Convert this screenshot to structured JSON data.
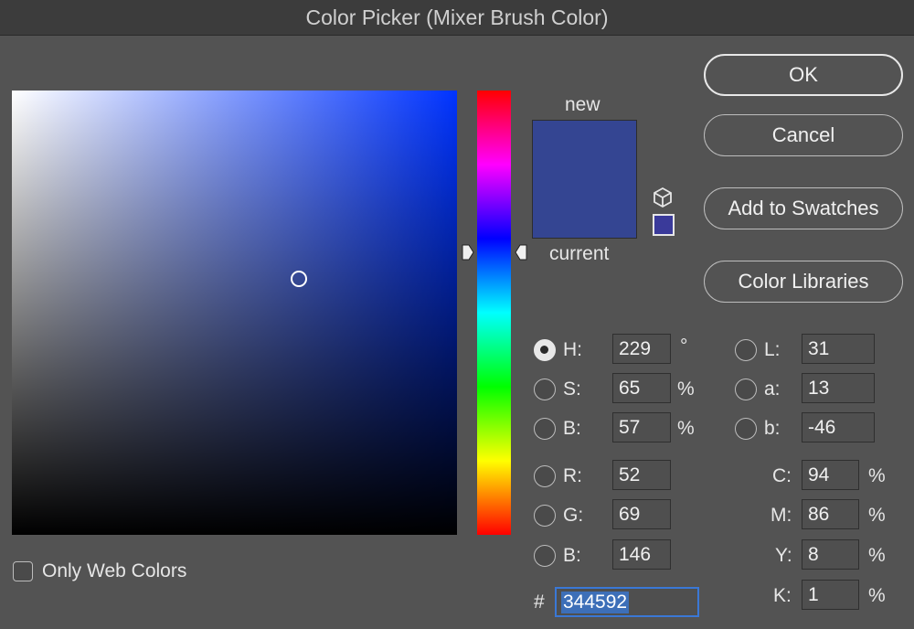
{
  "window": {
    "title": "Color Picker (Mixer Brush Color)"
  },
  "colors": {
    "new": "#344592",
    "current": "#344592",
    "gamut": "#3a3a9a"
  },
  "swatch": {
    "new_label": "new",
    "current_label": "current"
  },
  "buttons": {
    "ok": "OK",
    "cancel": "Cancel",
    "add_to_swatches": "Add to Swatches",
    "color_libraries": "Color Libraries"
  },
  "hsb": {
    "h": {
      "label": "H:",
      "value": "229",
      "unit": "°"
    },
    "s": {
      "label": "S:",
      "value": "65",
      "unit": "%"
    },
    "b": {
      "label": "B:",
      "value": "57",
      "unit": "%"
    }
  },
  "rgb": {
    "r": {
      "label": "R:",
      "value": "52"
    },
    "g": {
      "label": "G:",
      "value": "69"
    },
    "b": {
      "label": "B:",
      "value": "146"
    }
  },
  "lab": {
    "l": {
      "label": "L:",
      "value": "31"
    },
    "a": {
      "label": "a:",
      "value": "13"
    },
    "b": {
      "label": "b:",
      "value": "-46"
    }
  },
  "cmyk": {
    "c": {
      "label": "C:",
      "value": "94",
      "unit": "%"
    },
    "m": {
      "label": "M:",
      "value": "86",
      "unit": "%"
    },
    "y": {
      "label": "Y:",
      "value": "8",
      "unit": "%"
    },
    "k": {
      "label": "K:",
      "value": "1",
      "unit": "%"
    }
  },
  "hex": {
    "label": "#",
    "value": "344592"
  },
  "web_colors": {
    "label": "Only Web Colors",
    "checked": false
  },
  "icons": {
    "gamut_warning": "cube-icon"
  }
}
